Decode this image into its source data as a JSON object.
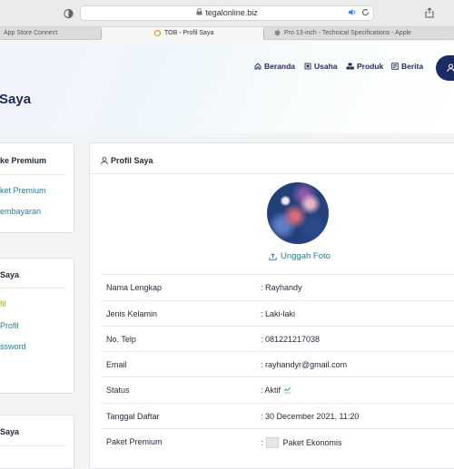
{
  "browser": {
    "url": "tegalonline.biz",
    "tabs": [
      {
        "label": "App Store Connect",
        "active": false
      },
      {
        "label": "TOB - Profil Saya",
        "active": true
      },
      {
        "label": "Pro 13-inch - Technical Specifications - Apple",
        "active": false
      }
    ]
  },
  "header": {
    "page_title": "Saya",
    "nav": [
      {
        "label": "Beranda",
        "icon": "home-icon"
      },
      {
        "label": "Usaha",
        "icon": "building-icon"
      },
      {
        "label": "Produk",
        "icon": "boxes-icon"
      },
      {
        "label": "Berita",
        "icon": "newspaper-icon"
      }
    ],
    "user_icon": "user-icon"
  },
  "sidebar": {
    "premium": {
      "title": "ke Premium",
      "items": [
        {
          "label": "ket Premium"
        },
        {
          "label": "embayaran"
        }
      ]
    },
    "account": {
      "title": "Saya",
      "items": [
        {
          "label": "fil",
          "active": true
        },
        {
          "label": "Profil"
        },
        {
          "label": "ssword"
        }
      ]
    },
    "store": {
      "title": "Saya"
    }
  },
  "profile": {
    "title": "Profil Saya",
    "upload_label": "Unggah Foto",
    "rows": [
      {
        "label": "Nama Lengkap",
        "value": ": Rayhandy"
      },
      {
        "label": "Jenis Kelamin",
        "value": ": Laki-laki"
      },
      {
        "label": "No. Telp",
        "value": ": 081221217038"
      },
      {
        "label": "Email",
        "value": ": rayhandyr@gmail.com"
      },
      {
        "label": "Status",
        "value": ": Aktif"
      },
      {
        "label": "Tanggal Daftar",
        "value": ": 30 December 2021, 11:20"
      },
      {
        "label": "Paket Premium",
        "value": "Paket Ekonomis"
      }
    ],
    "premium_prefix": ":",
    "colors": {
      "accent": "#1a2c63",
      "link": "#2b7a9b",
      "active": "#d49a17",
      "status_ok": "#3aa757"
    }
  }
}
